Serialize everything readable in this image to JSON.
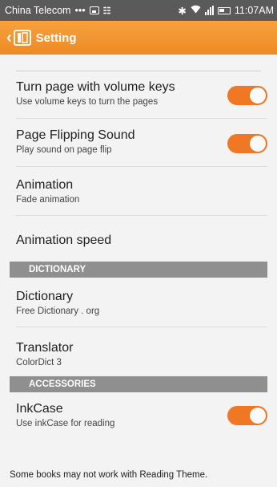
{
  "status_bar": {
    "carrier": "China Telecom",
    "dots": "•••",
    "time": "11:07AM"
  },
  "app_bar": {
    "title": "Setting"
  },
  "settings": [
    {
      "title": "Turn page with volume keys",
      "subtitle": "Use volume keys to turn the pages",
      "toggle": true,
      "toggle_on": true
    },
    {
      "title": "Page Flipping Sound",
      "subtitle": "Play sound on page flip",
      "toggle": true,
      "toggle_on": true
    },
    {
      "title": "Animation",
      "subtitle": "Fade animation",
      "toggle": false
    },
    {
      "title": "Animation speed",
      "subtitle": "",
      "toggle": false
    }
  ],
  "sections": [
    {
      "header": "DICTIONARY",
      "items": [
        {
          "title": "Dictionary",
          "subtitle": "Free Dictionary . org"
        },
        {
          "title": "Translator",
          "subtitle": "ColorDict 3"
        }
      ]
    },
    {
      "header": "ACCESSORIES",
      "items": [
        {
          "title": "InkCase",
          "subtitle": "Use inkCase for reading",
          "toggle": true,
          "toggle_on": true
        }
      ]
    }
  ],
  "footer_note": "Some books may not work with Reading Theme.",
  "colors": {
    "accent": "#f07825",
    "app_bar": "#ee8a24",
    "section_header": "#8f8f8f"
  }
}
